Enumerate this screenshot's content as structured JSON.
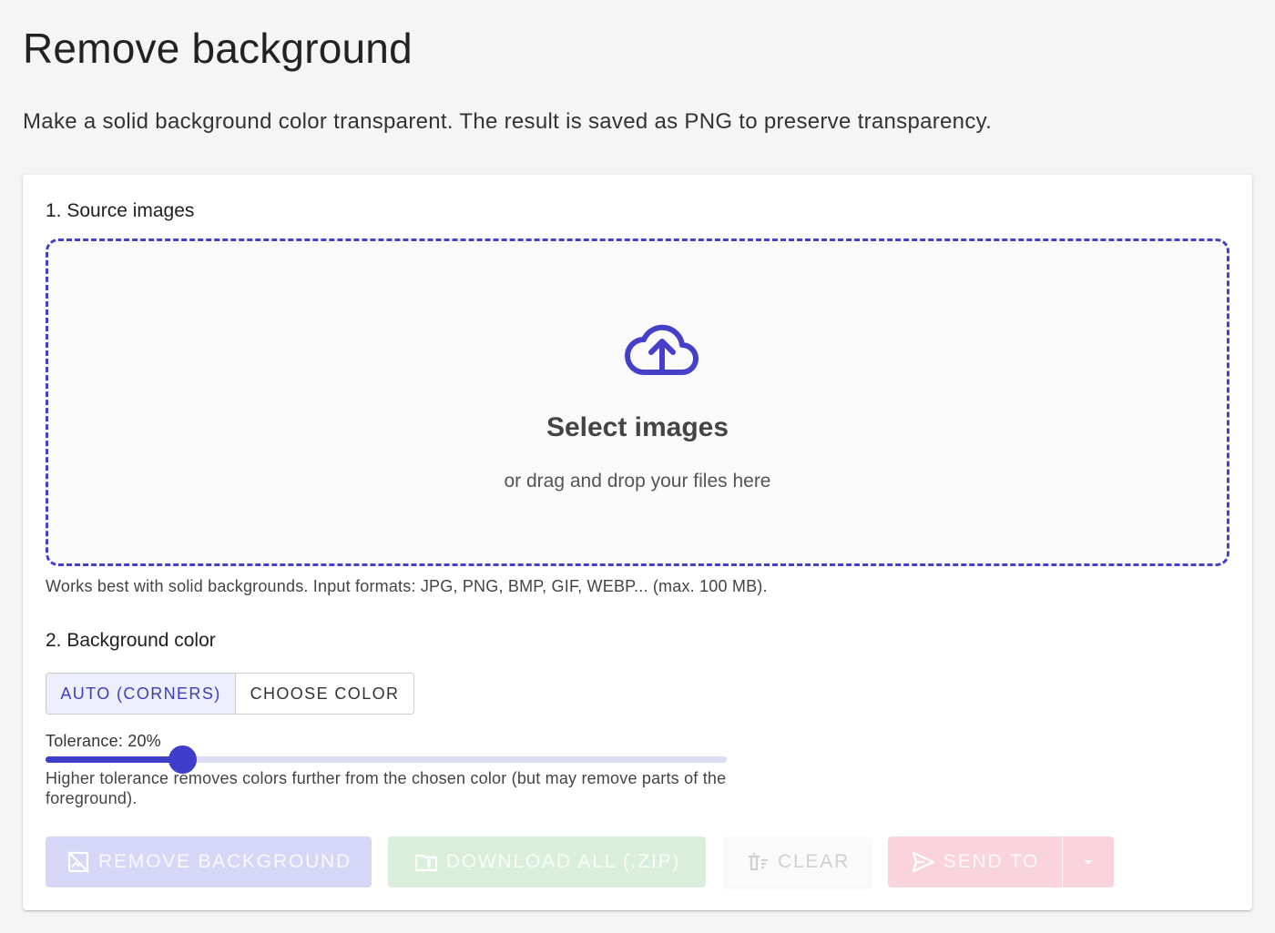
{
  "header": {
    "title": "Remove background",
    "subtitle": "Make a solid background color transparent. The result is saved as PNG to preserve transparency."
  },
  "source": {
    "section_title": "1. Source images",
    "drop_title": "Select images",
    "drop_subtitle": "or drag and drop your files here",
    "helper": "Works best with solid backgrounds. Input formats: JPG, PNG, BMP, GIF, WEBP... (max. 100 MB)."
  },
  "background_color": {
    "section_title": "2. Background color",
    "modes": [
      "AUTO (CORNERS)",
      "CHOOSE COLOR"
    ],
    "selected_mode": "AUTO (CORNERS)"
  },
  "tolerance": {
    "label": "Tolerance: 20%",
    "value_percent": 20,
    "helper": "Higher tolerance removes colors further from the chosen color (but may remove parts of the foreground)."
  },
  "actions": {
    "remove_label": "REMOVE BACKGROUND",
    "download_label": "DOWNLOAD ALL (.ZIP)",
    "clear_label": "CLEAR",
    "send_label": "SEND TO"
  },
  "colors": {
    "accent": "#3f3dcc",
    "dropzone_border": "#4540c9",
    "remove_disabled": "#d6d6f6",
    "download_disabled": "#d9eedb",
    "send_disabled": "#f9d4dd"
  },
  "icons": {
    "upload": "cloud-upload-icon",
    "remove": "hide-image-icon",
    "download": "folder-zip-icon",
    "clear": "delete-sweep-icon",
    "send": "send-icon",
    "menu": "caret-down-icon"
  }
}
